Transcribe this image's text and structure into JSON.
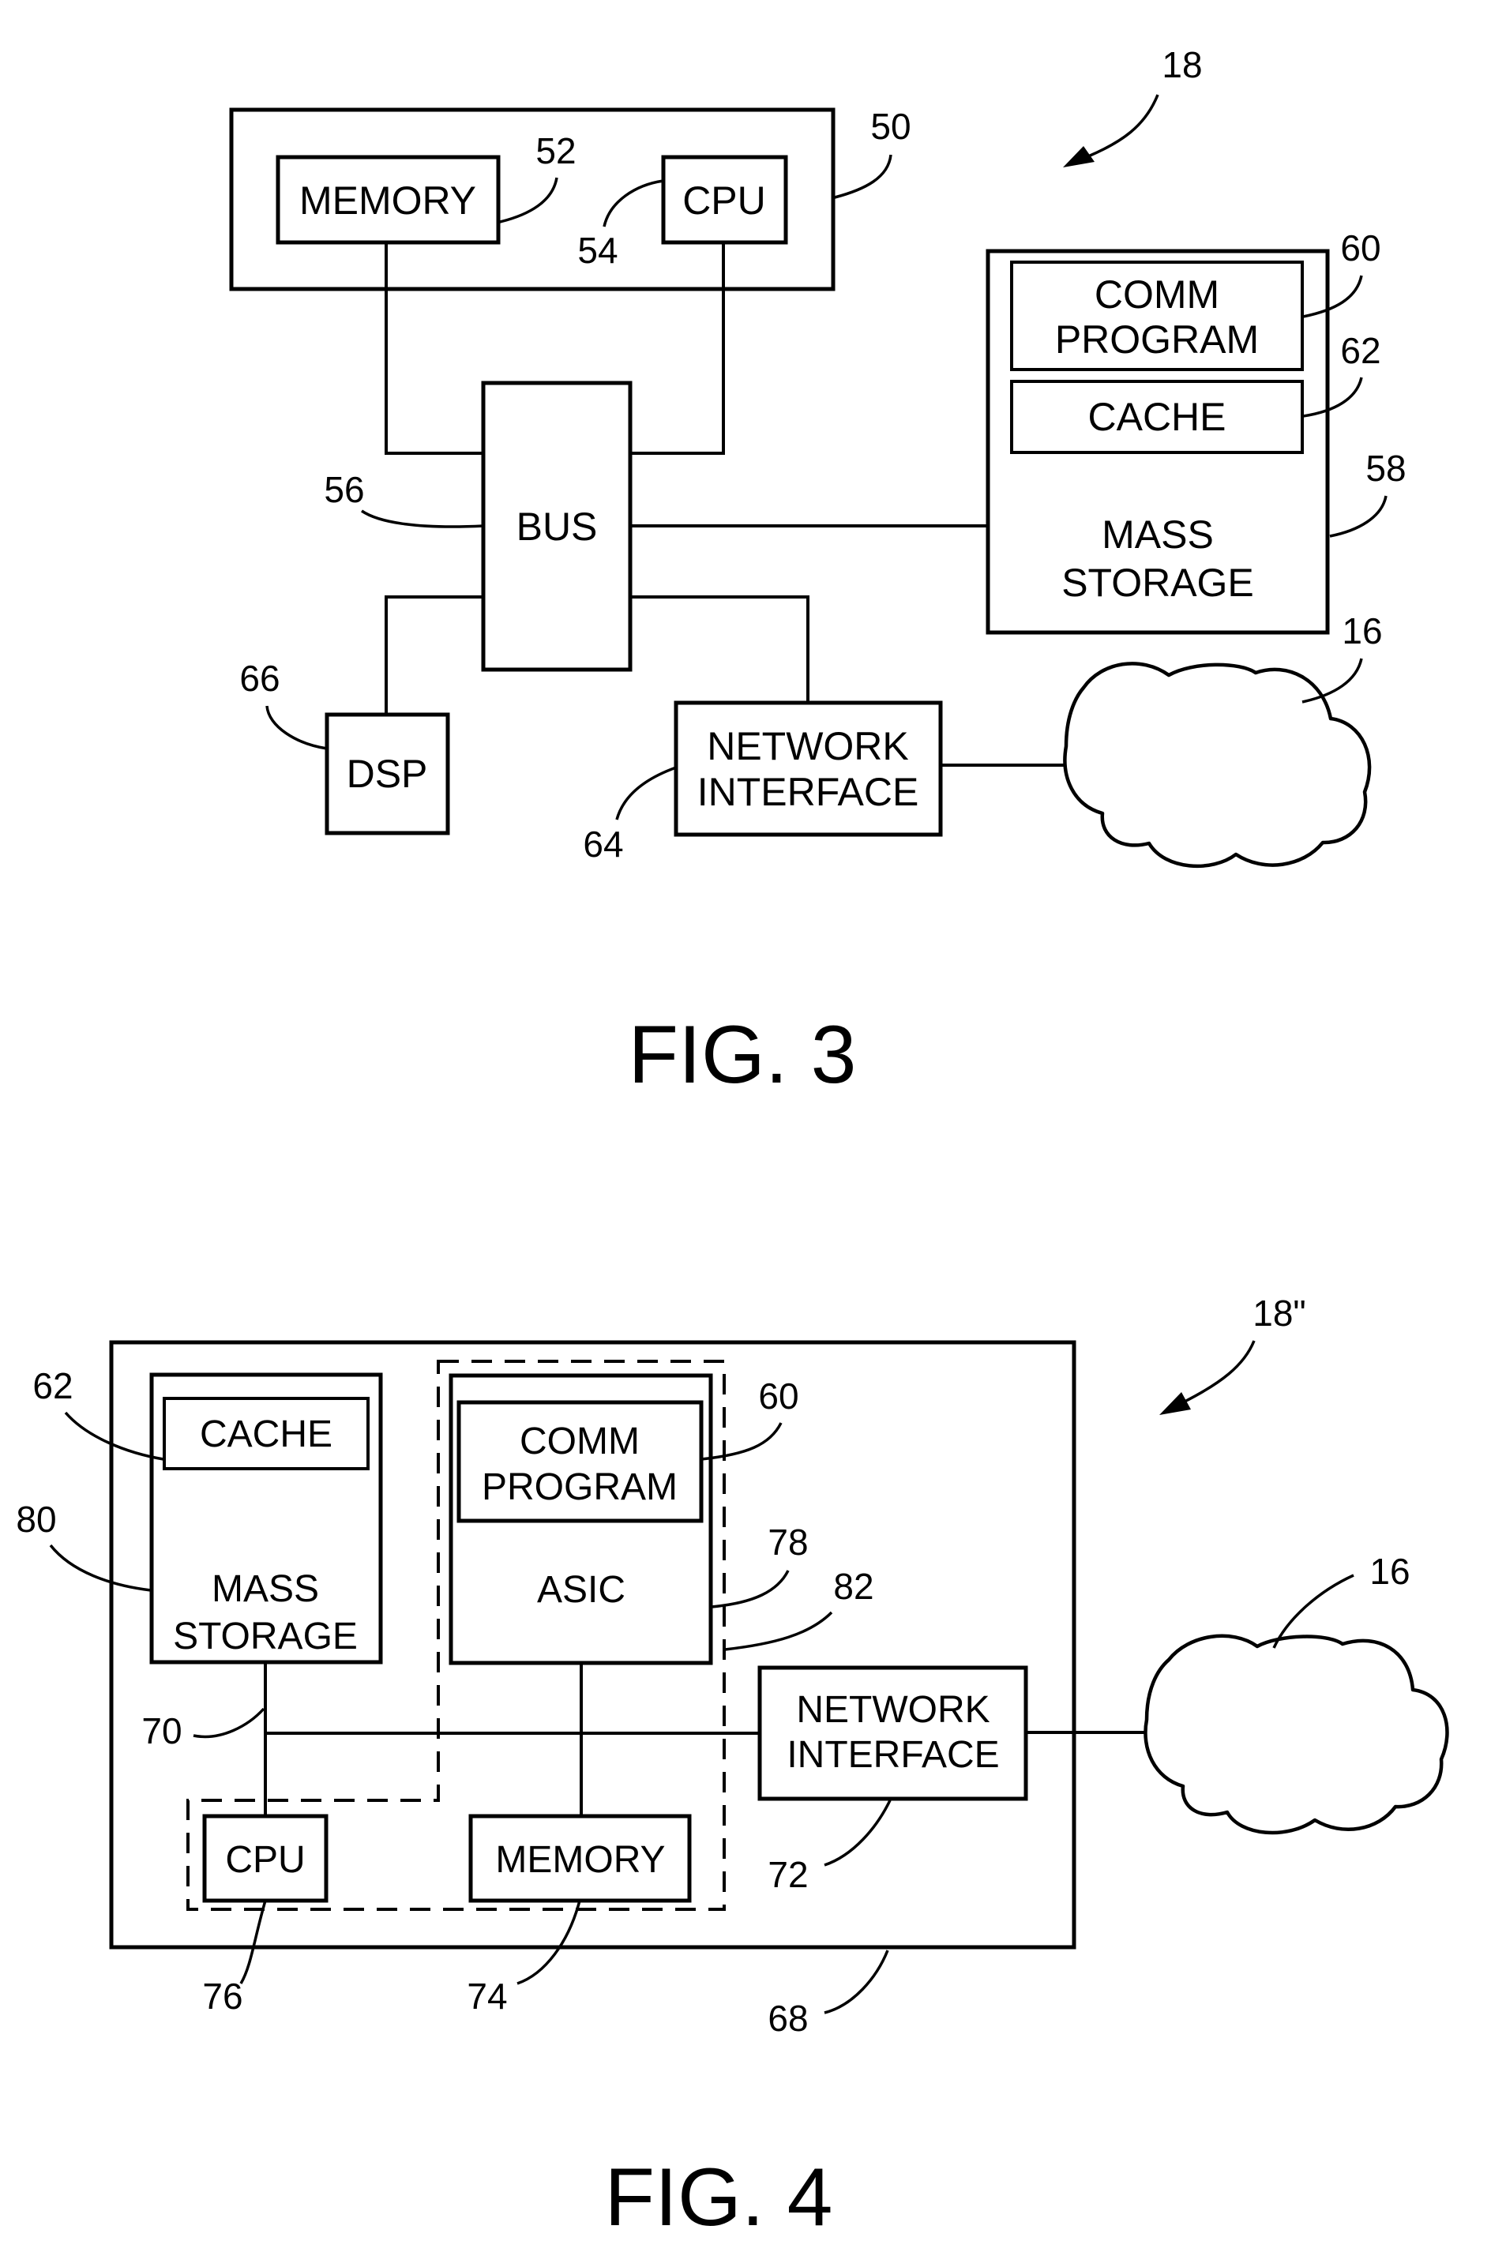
{
  "page": {
    "type": "patent drawing sheet",
    "background": "#ffffff",
    "ink": "#000000"
  },
  "fig3": {
    "caption": "FIG. 3",
    "system_ref": "18",
    "host_ref": "50",
    "memory": {
      "label": "MEMORY",
      "ref": "52"
    },
    "cpu": {
      "label": "CPU",
      "ref": "54"
    },
    "bus": {
      "label": "BUS",
      "ref": "56"
    },
    "mass_storage": {
      "label_line1": "MASS",
      "label_line2": "STORAGE",
      "ref": "58"
    },
    "comm_program": {
      "label_line1": "COMM",
      "label_line2": "PROGRAM",
      "ref": "60"
    },
    "cache": {
      "label": "CACHE",
      "ref": "62"
    },
    "network_interface": {
      "label_line1": "NETWORK",
      "label_line2": "INTERFACE",
      "ref": "64"
    },
    "dsp": {
      "label": "DSP",
      "ref": "66"
    },
    "network": {
      "ref": "16"
    }
  },
  "fig4": {
    "caption": "FIG. 4",
    "system_ref": "18\"",
    "enclosure_ref": "68",
    "bus_ref": "70",
    "mass_storage": {
      "label_line1": "MASS",
      "label_line2": "STORAGE",
      "ref": "80"
    },
    "cache": {
      "label": "CACHE",
      "ref": "62"
    },
    "asic": {
      "label": "ASIC",
      "ref": "78"
    },
    "comm_program": {
      "label_line1": "COMM",
      "label_line2": "PROGRAM",
      "ref": "60"
    },
    "dashed_region_ref": "82",
    "cpu": {
      "label": "CPU",
      "ref": "76"
    },
    "memory": {
      "label": "MEMORY",
      "ref": "74"
    },
    "network_interface": {
      "label_line1": "NETWORK",
      "label_line2": "INTERFACE",
      "ref": "72"
    },
    "network": {
      "ref": "16"
    }
  }
}
